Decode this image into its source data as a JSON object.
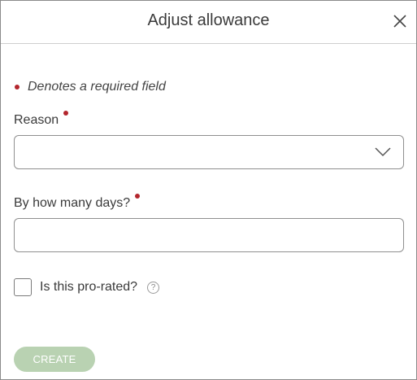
{
  "dialog": {
    "title": "Adjust allowance"
  },
  "required_note": "Denotes a required field",
  "reason": {
    "label": "Reason",
    "selected_value": ""
  },
  "days": {
    "label": "By how many days?",
    "value": "",
    "placeholder": ""
  },
  "prorated": {
    "label": "Is this pro-rated?",
    "help_symbol": "?",
    "checked": false
  },
  "actions": {
    "create_label": "CREATE"
  },
  "colors": {
    "required_marker": "#b3262d",
    "create_button_disabled": "#b9d2b2"
  },
  "icons": {
    "close": "close-icon",
    "dropdown": "chevron-down-icon",
    "help": "help-icon"
  }
}
